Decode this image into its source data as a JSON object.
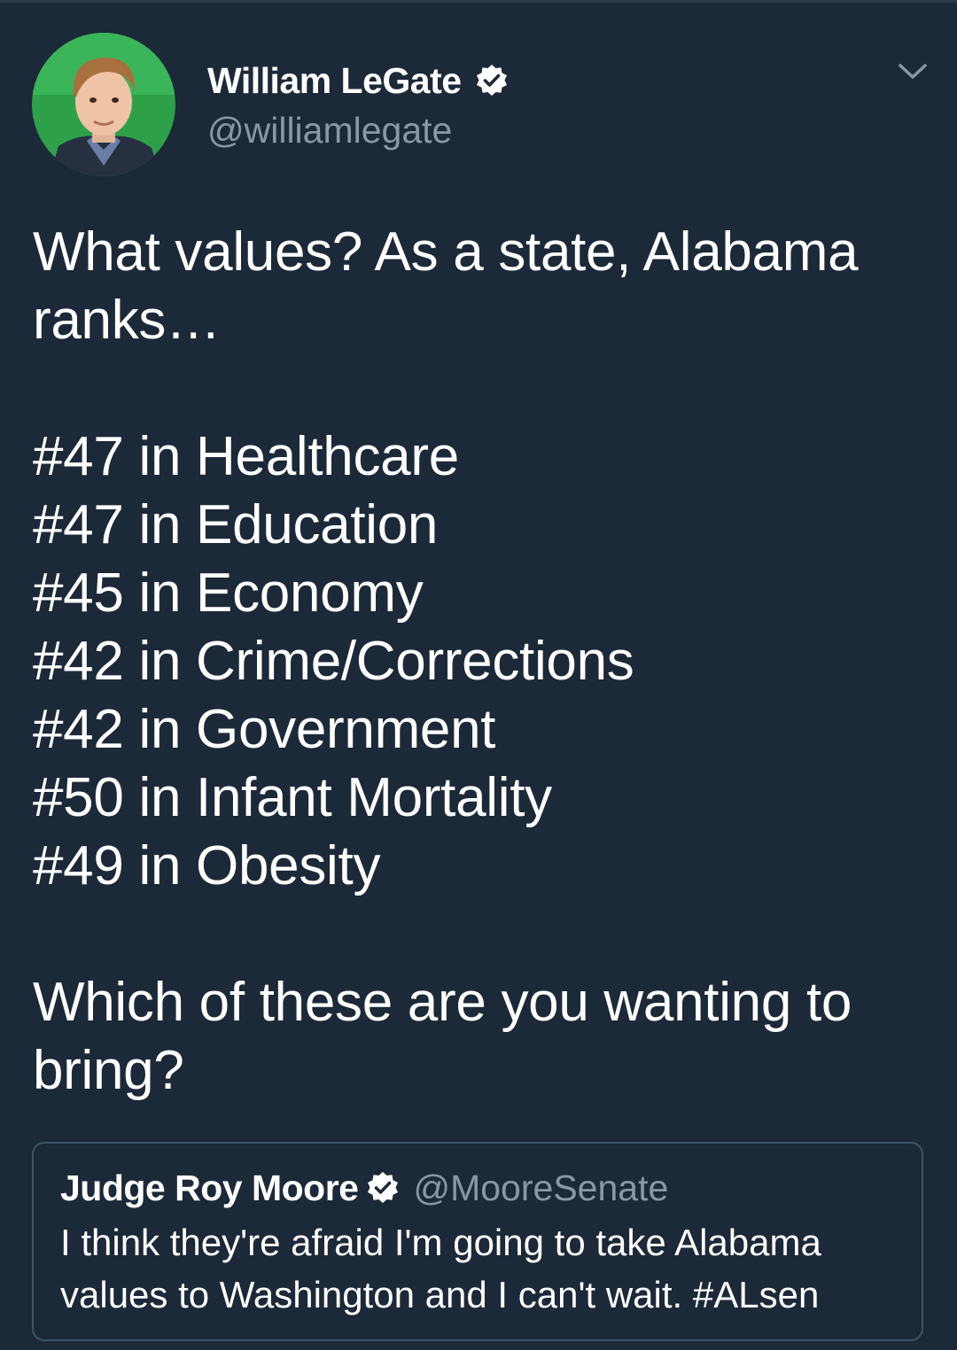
{
  "tweet": {
    "author": {
      "display_name": "William LeGate",
      "handle": "@williamlegate",
      "verified": true
    },
    "text_intro": "What values? As a state, Alabama ranks…",
    "ranks": [
      "#47 in Healthcare",
      "#47 in Education",
      "#45 in Economy",
      "#42 in Crime/Corrections",
      "#42 in Government",
      "#50 in Infant Mortality",
      "#49 in Obesity"
    ],
    "text_outro": "Which of these are you wanting to bring?"
  },
  "quoted_tweet": {
    "display_name": "Judge Roy Moore",
    "handle": "@MooreSenate",
    "verified": true,
    "text": "I think they're afraid I'm going to take Alabama values to Washington and I can't wait. #ALsen"
  },
  "icons": {
    "verified": "verified-badge-icon",
    "menu": "chevron-down-icon"
  },
  "colors": {
    "background": "#1c2938",
    "secondary_text": "#8899a6",
    "quote_border": "#3d5466"
  }
}
